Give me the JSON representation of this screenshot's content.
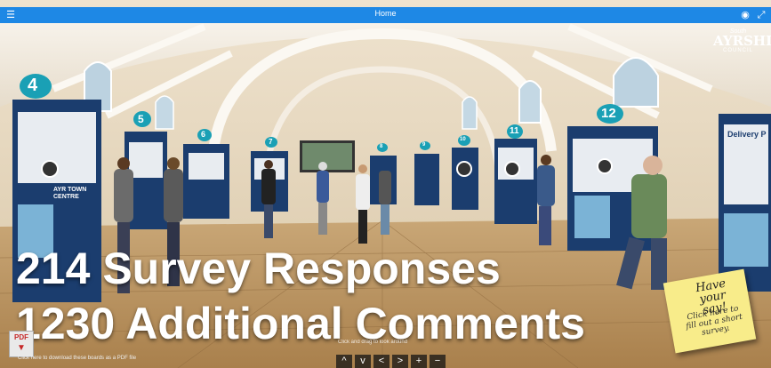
{
  "header": {
    "title": "Home",
    "menu_icon": "menu-collapse-icon",
    "right_icons": [
      "view-icon",
      "fullscreen-icon"
    ]
  },
  "logo": {
    "line1": "South",
    "line2": "AYRSHIRE",
    "line3": "COUNCIL"
  },
  "boards": {
    "numbers": [
      "4",
      "5",
      "6",
      "7",
      "8",
      "9",
      "10",
      "11",
      "12"
    ],
    "panel_title": "AYR TOWN CENTRE",
    "panel_title_right": "Delivery P"
  },
  "overlay": {
    "line1": "214 Survey Responses",
    "line2": "1230 Additional Comments"
  },
  "sticky_note": {
    "have": "Have your say!",
    "click": "Click here to fill out a short survey."
  },
  "pdf": {
    "label": "PDF",
    "caption": "Click here to download these boards as a PDF file"
  },
  "hint": "Click and drag to look around",
  "nav": {
    "buttons": [
      "^",
      "v",
      "<",
      ">",
      "+",
      "−"
    ]
  },
  "colors": {
    "topbar": "#1e88e5",
    "board": "#1b3d6e",
    "circle_label": "#1aa0b5",
    "sticky": "#f8ec8a"
  }
}
